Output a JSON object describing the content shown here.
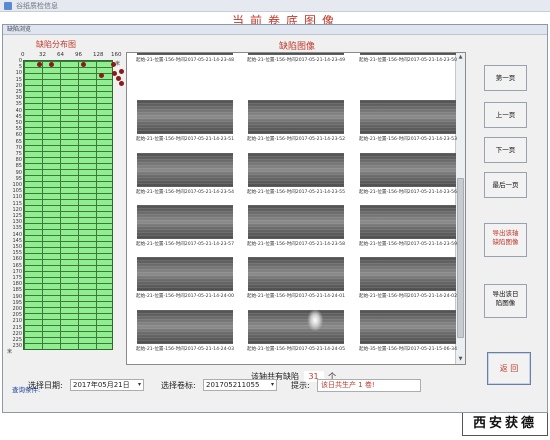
{
  "window": {
    "background_title": "谷纸质检信息",
    "background_heading": "当前卷底图像",
    "dialog_title": "缺陷浏览",
    "brand": "西安获德"
  },
  "distribution": {
    "title": "缺陷分布图",
    "x_ticks": [
      "0",
      "32",
      "64",
      "96",
      "128",
      "160"
    ],
    "y_ticks": [
      "0",
      "5",
      "10",
      "15",
      "20",
      "25",
      "30",
      "35",
      "40",
      "45",
      "50",
      "55",
      "60",
      "65",
      "70",
      "75",
      "80",
      "85",
      "90",
      "95",
      "100",
      "105",
      "110",
      "115",
      "120",
      "125",
      "130",
      "135",
      "140",
      "145",
      "150",
      "155",
      "160",
      "165",
      "170",
      "175",
      "180",
      "185",
      "190",
      "195",
      "200",
      "205",
      "210",
      "215",
      "220",
      "225",
      "230"
    ],
    "side_label": "米",
    "y_end_label": "米",
    "dot_color": "#8b1a1a",
    "grid_color": "#90ee90"
  },
  "gallery": {
    "title": "缺陷图像",
    "captions": [
      "起始-21-位置-156-时间2017-05-21-14-23-48",
      "起始-21-位置-156-时间2017-05-21-14-23-49",
      "起始-21-位置-156-时间2017-05-21-14-23-50",
      "起始-21-位置-156-时间2017-05-21-14-23-51",
      "起始-21-位置-156-时间2017-05-21-14-23-52",
      "起始-21-位置-156-时间2017-05-21-14-23-53",
      "起始-21-位置-156-时间2017-05-21-14-23-54",
      "起始-21-位置-156-时间2017-05-21-14-23-55",
      "起始-21-位置-156-时间2017-05-21-14-23-56",
      "起始-21-位置-156-时间2017-05-21-14-23-57",
      "起始-21-位置-156-时间2017-05-21-14-23-58",
      "起始-21-位置-156-时间2017-05-21-14-23-59",
      "起始-21-位置-156-时间2017-05-21-14-24-00",
      "起始-21-位置-156-时间2017-05-21-14-24-01",
      "起始-21-位置-156-时间2017-05-21-14-24-02",
      "起始-21-位置-156-时间2017-05-21-14-24-03",
      "起始-21-位置-156-时间2017-05-21-14-24-05",
      "起始-35-位置-156-时间2017-05-21-15-06-34"
    ],
    "count_prefix": "该轴共有缺陷",
    "count_value": "31",
    "count_suffix": "个"
  },
  "buttons": {
    "first": "第一页",
    "prev": "上一页",
    "next": "下一页",
    "last": "最后一页",
    "export_axis": "导出该轴缺陷图像",
    "export_day": "导出该日陷图像",
    "back": "返 回"
  },
  "query": {
    "label": "查询条件:",
    "date_label": "选择日期:",
    "date_value": "2017年05月21日",
    "roll_label": "选择卷标:",
    "roll_value": "201705211055",
    "tip_label": "提示:",
    "tip_value": "该日共生产 1 卷!"
  }
}
